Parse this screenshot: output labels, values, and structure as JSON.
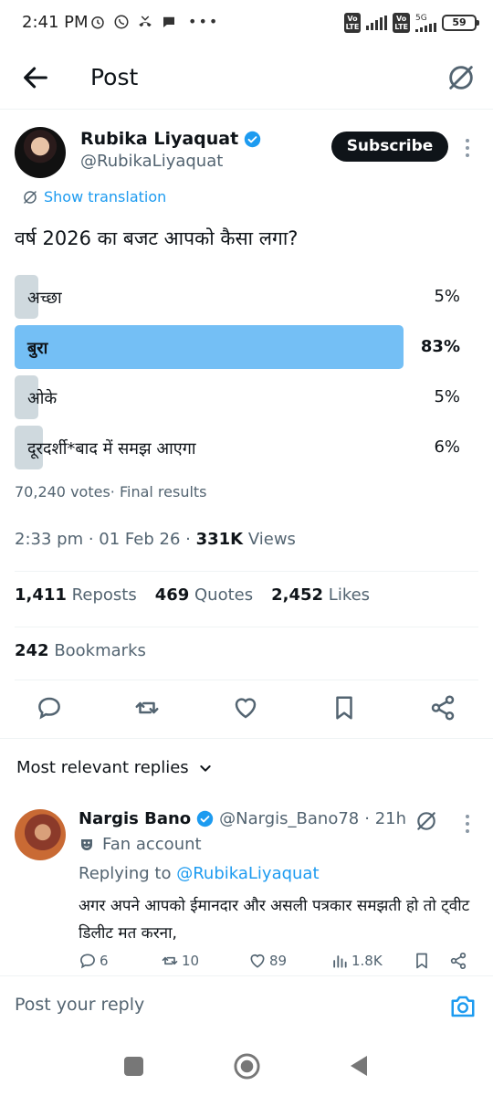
{
  "status_bar": {
    "time": "2:41 PM",
    "network": "5G",
    "battery": "59"
  },
  "header": {
    "title": "Post"
  },
  "post": {
    "author_name": "Rubika Liyaquat",
    "author_handle": "@RubikaLiyaquat",
    "subscribe_label": "Subscribe",
    "translation_label": "Show translation",
    "question": "वर्ष 2026 का बजट आपको कैसा लगा?",
    "poll": [
      {
        "label": "अच्छा",
        "percent": "5%",
        "fraction": 0.05,
        "winner": false
      },
      {
        "label": "बुरा",
        "percent": "83%",
        "fraction": 0.83,
        "winner": true
      },
      {
        "label": "ओके",
        "percent": "5%",
        "fraction": 0.05,
        "winner": false
      },
      {
        "label": "दूरदर्शी*बाद में समझ आएगा",
        "percent": "6%",
        "fraction": 0.06,
        "winner": false
      }
    ],
    "votes": "70,240 votes",
    "poll_status": "· Final results",
    "time": "2:33 pm",
    "date": "01 Feb 26",
    "views_count": "331K",
    "views_label": "Views",
    "reposts_count": "1,411",
    "reposts_label": "Reposts",
    "quotes_count": "469",
    "quotes_label": "Quotes",
    "likes_count": "2,452",
    "likes_label": "Likes",
    "bookmarks_count": "242",
    "bookmarks_label": "Bookmarks"
  },
  "replies_section": {
    "sort_label": "Most relevant replies"
  },
  "reply": {
    "name": "Nargis Bano",
    "handle": "@Nargis_Bano78",
    "age": "· 21h",
    "badge": "Fan account",
    "replying_prefix": "Replying to",
    "replying_to": "@RubikaLiyaquat",
    "text": "अगर अपने आपको ईमानदार और असली पत्रकार समझती हो तो ट्वीट डिलीट मत करना,",
    "replies": "6",
    "reposts": "10",
    "likes": "89",
    "views": "1.8K"
  },
  "composer": {
    "placeholder": "Post your reply"
  },
  "colors": {
    "accent": "#1d9bf0",
    "poll_winner": "#74bff5",
    "poll_other": "#cfd9de",
    "text": "#0f1419",
    "secondary": "#536471"
  }
}
